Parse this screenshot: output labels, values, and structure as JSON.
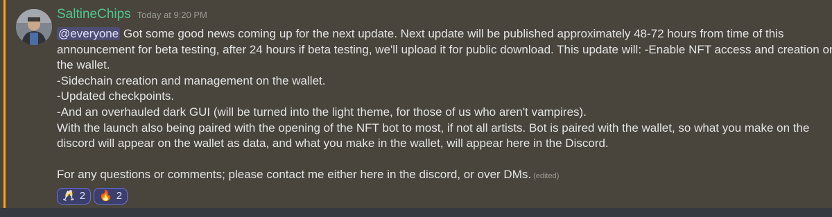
{
  "message": {
    "username": "SaltineChips",
    "timestamp": "Today at 9:20 PM",
    "mention": "@everyone",
    "lines": [
      " Got some good news coming up for the next update. Next update will be published approximately 48-72 hours from time of this",
      "announcement for beta testing, after 24 hours if beta testing, we'll upload it for public download. This update will: -Enable NFT access and creation on",
      "the wallet.",
      "-Sidechain creation and management on the wallet.",
      "-Updated checkpoints.",
      "-And an overhauled dark GUI (will be turned into the light theme, for those of us who aren't vampires).",
      "With the launch also being paired with the opening of the NFT bot to most, if not all artists. Bot is paired with the wallet, so what you make on the",
      "discord will appear on the wallet as data, and what you make in the wallet, will appear here in the Discord.",
      "",
      "For any questions or comments; please contact me either here in the discord, or over DMs."
    ],
    "edited_label": "(edited)"
  },
  "reactions": [
    {
      "emoji": "🥂",
      "icon": "clinking-glasses-icon",
      "count": "2"
    },
    {
      "emoji": "🔥",
      "icon": "fire-icon",
      "count": "2"
    }
  ],
  "colors": {
    "background": "#36393f",
    "mention_highlight": "#49443c",
    "mention_bar": "#faa81a",
    "username": "#4ec98e",
    "reaction_border": "#6a72e0"
  }
}
